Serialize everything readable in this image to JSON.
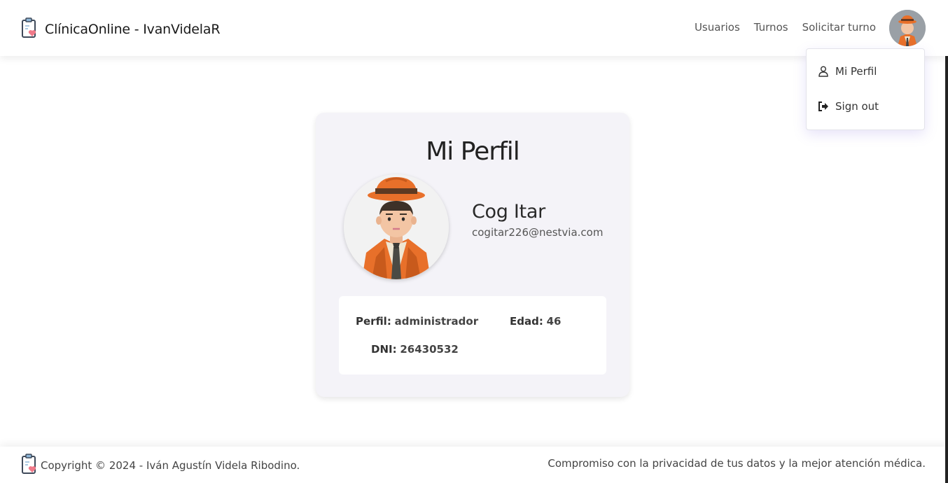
{
  "navbar": {
    "brand": "ClínicaOnline - IvanVidelaR",
    "brand_icon": "clipboard-heart-icon",
    "links": [
      "Usuarios",
      "Turnos",
      "Solicitar turno"
    ]
  },
  "dropdown": {
    "items": [
      {
        "label": "Mi Perfil",
        "icon": "user-icon"
      },
      {
        "label": "Sign out",
        "icon": "sign-out-icon"
      }
    ]
  },
  "profile": {
    "title": "Mi Perfil",
    "name": "Cog Itar",
    "email": "cogitar226@nestvia.com",
    "perfil_label": "Perfil:",
    "perfil_value": "administrador",
    "edad_label": "Edad:",
    "edad_value": "46",
    "dni_label": "DNI:",
    "dni_value": "26430532"
  },
  "footer": {
    "copyright": "Copyright © 2024 - Iván Agustín Videla Ribodino.",
    "tagline": "Compromiso con la privacidad de tus datos y la mejor atención médica."
  },
  "colors": {
    "accent_orange": "#e8702a",
    "card_bg": "#f4f3f8",
    "text_dark": "#222222"
  }
}
